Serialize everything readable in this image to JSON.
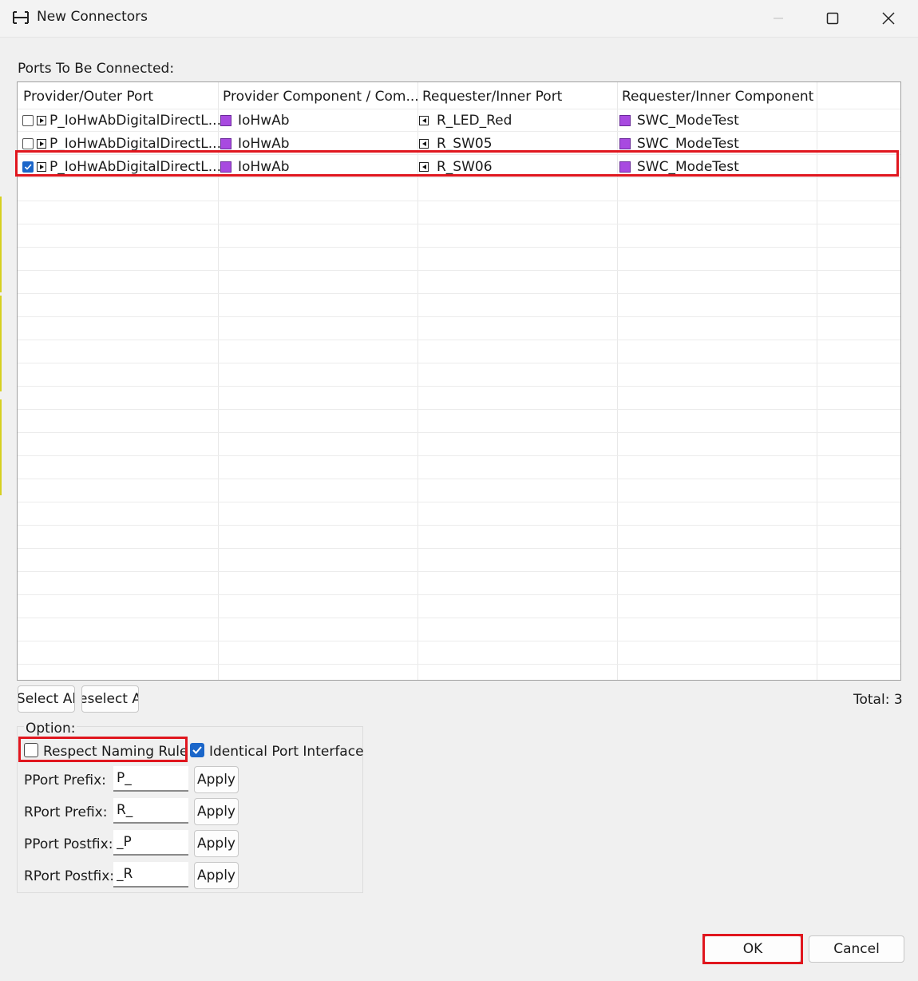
{
  "window": {
    "title": "New Connectors",
    "icons": {
      "app": "connector-icon",
      "minimize": "minimize-icon",
      "maximize": "maximize-icon",
      "close": "close-icon"
    }
  },
  "ports_label": "Ports To Be Connected:",
  "table": {
    "columns": [
      "Provider/Outer Port",
      "Provider Component / Com...",
      "Requester/Inner Port",
      "Requester/Inner Component"
    ],
    "rows": [
      {
        "checked": false,
        "provider_port": "P_IoHwAbDigitalDirectL...",
        "provider_component": "IoHwAb",
        "requester_port": "R_LED_Red",
        "requester_component": "SWC_ModeTest"
      },
      {
        "checked": false,
        "provider_port": "P_IoHwAbDigitalDirectL...",
        "provider_component": "IoHwAb",
        "requester_port": "R_SW05",
        "requester_component": "SWC_ModeTest"
      },
      {
        "checked": true,
        "provider_port": "P_IoHwAbDigitalDirectL...",
        "provider_component": "IoHwAb",
        "requester_port": "R_SW06",
        "requester_component": "SWC_ModeTest"
      }
    ]
  },
  "buttons": {
    "select_all": "Select Al",
    "deselect_all": "eselect A",
    "ok": "OK",
    "cancel": "Cancel"
  },
  "total": "Total: 3",
  "options": {
    "label": "Option:",
    "respect_naming_rule": {
      "label": "Respect Naming Rule",
      "checked": false
    },
    "identical_port_interface": {
      "label": "Identical Port Interface",
      "checked": true
    },
    "pport_prefix": {
      "label": "PPort Prefix:",
      "value": "P_"
    },
    "rport_prefix": {
      "label": "RPort Prefix:",
      "value": "R_"
    },
    "pport_postfix": {
      "label": "PPort Postfix:",
      "value": "_P"
    },
    "rport_postfix": {
      "label": "RPort Postfix:",
      "value": "_R"
    },
    "apply_label": "Apply"
  },
  "colors": {
    "highlight": "#e0161e",
    "checkbox_on": "#1b66c9",
    "component_icon": "#a84ae0"
  }
}
